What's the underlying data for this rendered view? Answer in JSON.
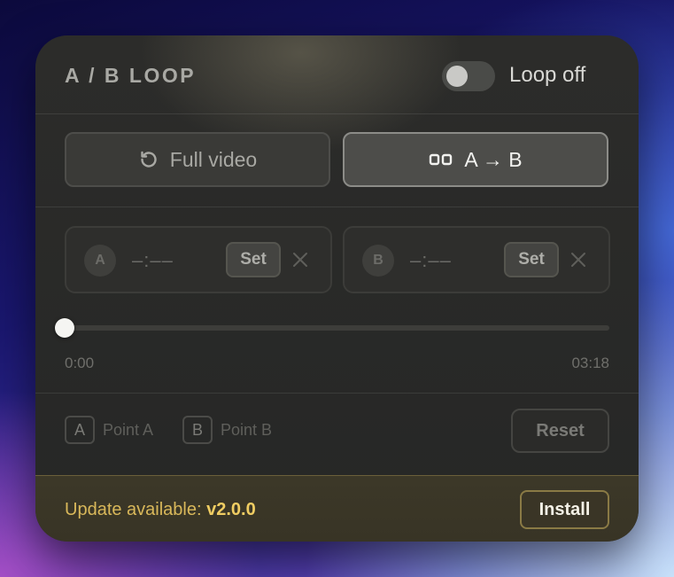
{
  "header": {
    "title": "A / B LOOP",
    "toggle_label": "Loop off",
    "toggle_on": false
  },
  "modes": {
    "full_label": "Full video",
    "ab_label": "A → B",
    "selected": "ab"
  },
  "points": {
    "a": {
      "badge": "A",
      "time": "–:––",
      "set_label": "Set"
    },
    "b": {
      "badge": "B",
      "time": "–:––",
      "set_label": "Set"
    }
  },
  "timeline": {
    "start_label": "0:00",
    "end_label": "03:18",
    "position_fraction": 0
  },
  "legend": {
    "a_key": "A",
    "a_label": "Point A",
    "b_key": "B",
    "b_label": "Point B"
  },
  "reset_label": "Reset",
  "update": {
    "prefix": "Update available: ",
    "version": "v2.0.0",
    "install_label": "Install"
  },
  "colors": {
    "update_accent": "#f0cd62",
    "panel_bg": "#2a2a28"
  },
  "icons": {
    "full": "rotate-ccw-icon",
    "ab": "loop-segment-icon",
    "clear": "close-icon"
  }
}
